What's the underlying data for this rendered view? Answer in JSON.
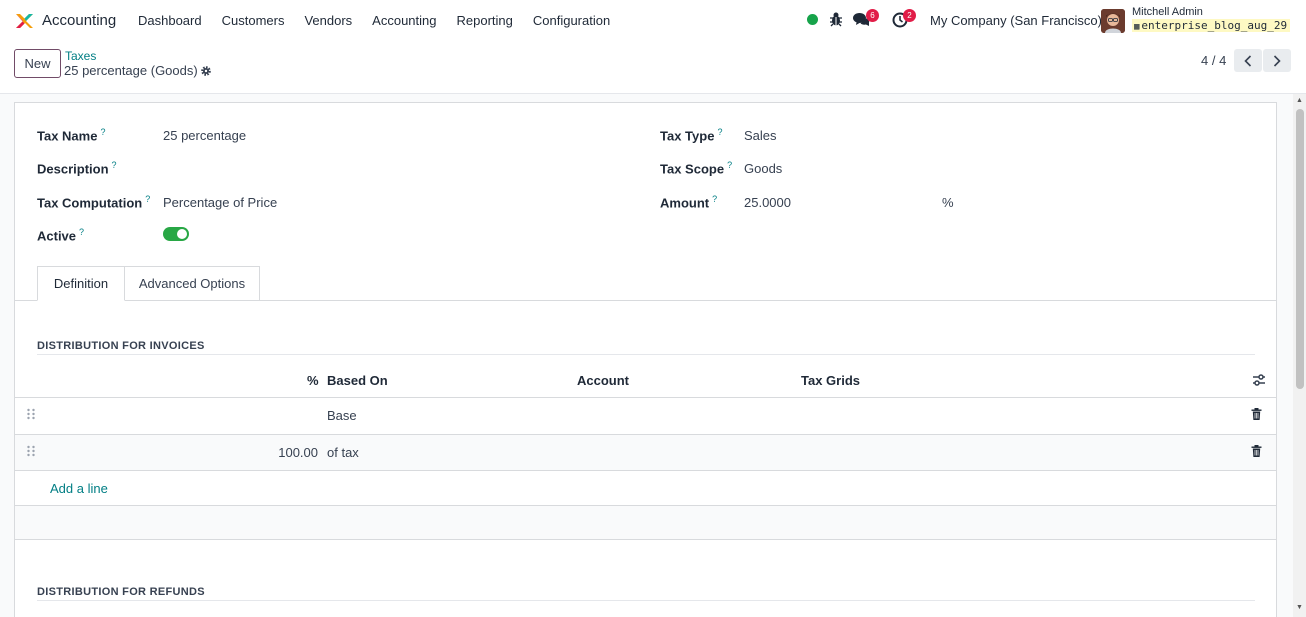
{
  "app": {
    "name": "Accounting"
  },
  "menu": [
    "Dashboard",
    "Customers",
    "Vendors",
    "Accounting",
    "Reporting",
    "Configuration"
  ],
  "systray": {
    "messages_count": "6",
    "activities_count": "2",
    "company": "My Company (San Francisco)",
    "user_name": "Mitchell Admin",
    "database": "enterprise_blog_aug_29",
    "status_color": "#16a34a"
  },
  "control": {
    "new_label": "New",
    "breadcrumb_parent": "Taxes",
    "breadcrumb_current": "25 percentage (Goods)",
    "pager": "4 / 4"
  },
  "form": {
    "tax_name_label": "Tax Name",
    "tax_name": "25 percentage",
    "description_label": "Description",
    "tax_computation_label": "Tax Computation",
    "tax_computation": "Percentage of Price",
    "active_label": "Active",
    "active": true,
    "tax_type_label": "Tax Type",
    "tax_type": "Sales",
    "tax_scope_label": "Tax Scope",
    "tax_scope": "Goods",
    "amount_label": "Amount",
    "amount": "25.0000",
    "amount_unit": "%",
    "help_mark": "?"
  },
  "tabs": [
    "Definition",
    "Advanced Options"
  ],
  "invoices": {
    "title": "DISTRIBUTION FOR INVOICES",
    "columns": [
      "%",
      "Based On",
      "Account",
      "Tax Grids"
    ],
    "rows": [
      {
        "percent": "",
        "based_on": "Base"
      },
      {
        "percent": "100.00",
        "based_on": "of tax"
      }
    ],
    "add_line": "Add a line"
  },
  "refunds": {
    "title": "DISTRIBUTION FOR REFUNDS"
  },
  "colors": {
    "accent": "#017e84",
    "brand": "#714b67",
    "toggle_on": "#28a745",
    "badge": "#e11d48"
  }
}
